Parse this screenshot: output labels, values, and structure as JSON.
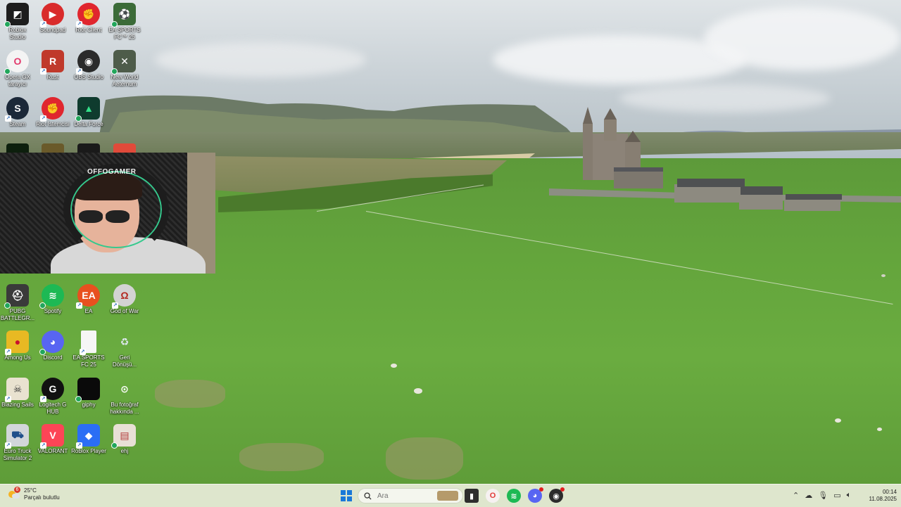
{
  "desktop": {
    "icons": [
      {
        "label": "Roblox\nStudio",
        "icon": "roblox-studio-icon",
        "color": "#1d1d1d",
        "glyph": "◩",
        "col": 0,
        "row": 0,
        "badge": "check"
      },
      {
        "label": "Soundpad",
        "icon": "soundpad-icon",
        "color": "#d92b2b",
        "glyph": "▶",
        "col": 1,
        "row": 0,
        "badge": "shortcut",
        "round": true
      },
      {
        "label": "Riot Client",
        "icon": "riot-client-icon",
        "color": "#e0262e",
        "glyph": "✊",
        "col": 2,
        "row": 0,
        "badge": "shortcut",
        "round": true
      },
      {
        "label": "EA SPORTS\nFC™ 25",
        "icon": "ea-fc25-icon",
        "color": "#3b6b38",
        "glyph": "⚽",
        "col": 3,
        "row": 0,
        "badge": "check"
      },
      {
        "label": "Opera GX\ntarayıcı",
        "icon": "opera-gx-icon",
        "color": "#f4f4f4",
        "glyph": "O",
        "col": 0,
        "row": 1,
        "badge": "check",
        "round": true,
        "fg": "#e23a6c"
      },
      {
        "label": "Rust",
        "icon": "rust-icon",
        "color": "#c0392b",
        "glyph": "R",
        "col": 1,
        "row": 1,
        "badge": "shortcut"
      },
      {
        "label": "OBS Studio",
        "icon": "obs-studio-icon",
        "color": "#2b2b2b",
        "glyph": "◉",
        "col": 2,
        "row": 1,
        "badge": "shortcut",
        "round": true
      },
      {
        "label": "New World\nAeternum",
        "icon": "new-world-icon",
        "color": "#4e5c4a",
        "glyph": "✕",
        "col": 3,
        "row": 1,
        "badge": "check"
      },
      {
        "label": "Steam",
        "icon": "steam-icon",
        "color": "#1b2838",
        "glyph": "S",
        "col": 0,
        "row": 2,
        "badge": "shortcut",
        "round": true
      },
      {
        "label": "Riot İstemcisi",
        "icon": "riot-client-icon",
        "color": "#e0262e",
        "glyph": "✊",
        "col": 1,
        "row": 2,
        "badge": "shortcut",
        "round": true
      },
      {
        "label": "Delta Force",
        "icon": "delta-force-icon",
        "color": "#0f3b2e",
        "glyph": "▲",
        "col": 2,
        "row": 2,
        "badge": "check",
        "fg": "#33e08a"
      },
      {
        "label": "PUBG\nBATTLEGR...",
        "icon": "pubg-icon",
        "color": "#3a3a3a",
        "glyph": "⛑",
        "col": 0,
        "row": 6,
        "badge": "check"
      },
      {
        "label": "Spotify",
        "icon": "spotify-icon",
        "color": "#1db954",
        "glyph": "≋",
        "col": 1,
        "row": 6,
        "badge": "check",
        "round": true
      },
      {
        "label": "EA",
        "icon": "ea-icon",
        "color": "#e8501f",
        "glyph": "EA",
        "col": 2,
        "row": 6,
        "badge": "shortcut",
        "round": true
      },
      {
        "label": "God of War",
        "icon": "god-of-war-icon",
        "color": "#d3d3d3",
        "glyph": "Ω",
        "col": 3,
        "row": 6,
        "badge": "shortcut",
        "round": true,
        "fg": "#b3261e"
      },
      {
        "label": "Among Us",
        "icon": "among-us-icon",
        "color": "#e8b923",
        "glyph": "●",
        "col": 0,
        "row": 7,
        "badge": "shortcut",
        "fg": "#c8102e"
      },
      {
        "label": "Discord",
        "icon": "discord-icon",
        "color": "#5865f2",
        "glyph": "◕",
        "col": 1,
        "row": 7,
        "badge": "check",
        "round": true
      },
      {
        "label": "EA SPORTS\nFC 25",
        "icon": "document-icon",
        "color": "#f6f6f6",
        "glyph": "",
        "col": 2,
        "row": 7,
        "badge": "shortcut"
      },
      {
        "label": "Geri\nDönüşü...",
        "icon": "recycle-bin-icon",
        "color": "transparent",
        "glyph": "♻",
        "col": 3,
        "row": 7,
        "badge": "none",
        "fg": "#dfe8f0"
      },
      {
        "label": "Blazing Sails",
        "icon": "blazing-sails-icon",
        "color": "#e9e2d0",
        "glyph": "☠",
        "col": 0,
        "row": 8,
        "badge": "shortcut",
        "fg": "#333"
      },
      {
        "label": "Logitech G\nHUB",
        "icon": "logitech-ghub-icon",
        "color": "#111",
        "glyph": "G",
        "col": 1,
        "row": 8,
        "badge": "shortcut",
        "round": true
      },
      {
        "label": "giphy",
        "icon": "giphy-icon",
        "color": "#0a0a0a",
        "glyph": "",
        "col": 2,
        "row": 8,
        "badge": "check"
      },
      {
        "label": "Bu fotoğraf\nhakkında ...",
        "icon": "camera-info-icon",
        "color": "transparent",
        "glyph": "⊙",
        "col": 3,
        "row": 8,
        "badge": "none",
        "round": true
      },
      {
        "label": "Euro Truck\nSimulator 2",
        "icon": "euro-truck-icon",
        "color": "#d2d6da",
        "glyph": "⛟",
        "col": 0,
        "row": 9,
        "badge": "shortcut",
        "fg": "#1f4f8a"
      },
      {
        "label": "VALORANT",
        "icon": "valorant-icon",
        "color": "#fd4556",
        "glyph": "V",
        "col": 1,
        "row": 9,
        "badge": "shortcut"
      },
      {
        "label": "Roblox Player",
        "icon": "roblox-player-icon",
        "color": "#2b6ef5",
        "glyph": "◆",
        "col": 2,
        "row": 9,
        "badge": "shortcut"
      },
      {
        "label": "ehj",
        "icon": "image-file-icon",
        "color": "#e8e0d6",
        "glyph": "▤",
        "col": 3,
        "row": 9,
        "badge": "check",
        "fg": "#b23a3a"
      }
    ],
    "partial_icons": [
      {
        "icon": "nvidia-icon",
        "color": "#0d1f0d",
        "col": 0
      },
      {
        "icon": "game-icon",
        "color": "#6a5a2a",
        "col": 1
      },
      {
        "icon": "calendar-app-icon",
        "color": "#1a1a1a",
        "col": 2
      },
      {
        "icon": "chrome-icon",
        "color": "#e04a3a",
        "col": 3
      }
    ]
  },
  "webcam": {
    "overlay_text": "OFFOGAMER"
  },
  "taskbar": {
    "weather": {
      "badge": "6",
      "temperature": "25°C",
      "condition": "Parçalı bulutlu"
    },
    "search": {
      "placeholder": "Ara"
    },
    "apps": [
      {
        "icon": "file-explorer-icon",
        "color": "#2d2d2d",
        "glyph": "▮"
      },
      {
        "icon": "opera-gx-icon",
        "color": "#f6f1f1",
        "glyph": "O",
        "fg": "#e23a3a"
      },
      {
        "icon": "spotify-icon",
        "color": "#1db954",
        "glyph": "≋"
      },
      {
        "icon": "discord-icon",
        "color": "#5865f2",
        "glyph": "◕",
        "notify": true
      },
      {
        "icon": "obs-studio-icon",
        "color": "#2b2b2b",
        "glyph": "◉",
        "notify": true
      }
    ],
    "tray": [
      "chevron-up-icon",
      "cloud-icon",
      "microphone-icon",
      "display-icon",
      "speaker-icon",
      "battery-icon"
    ],
    "clock": {
      "time": "00:14",
      "date": "11.08.2025"
    }
  },
  "colors": {
    "taskbar_bg": "#e2e8d2",
    "start_blue": "#1a78d8",
    "grass": "#64a53c"
  }
}
